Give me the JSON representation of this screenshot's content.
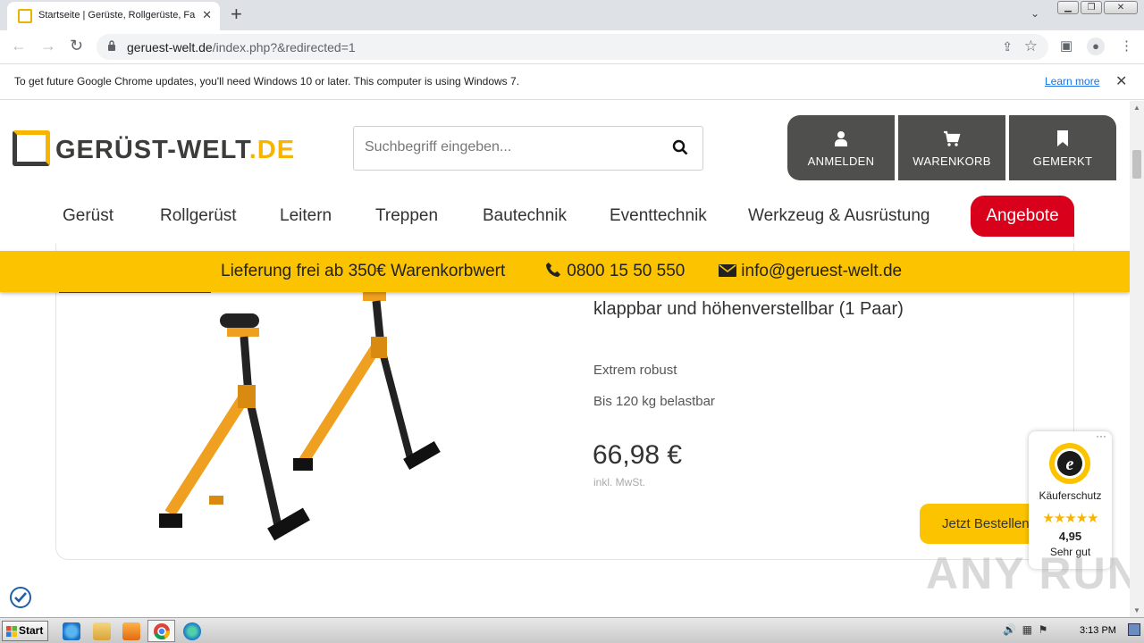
{
  "browser": {
    "tab_title": "Startseite | Gerüste, Rollgerüste, Fa",
    "url_domain": "geruest-welt.de",
    "url_path": "/index.php?&redirected=1"
  },
  "infobar": {
    "message": "To get future Google Chrome updates, you'll need Windows 10 or later. This computer is using Windows 7.",
    "learn_more": "Learn more"
  },
  "site": {
    "logo_main": "GERÜST-WELT",
    "logo_tld": ".DE",
    "search_placeholder": "Suchbegriff eingeben...",
    "header_buttons": [
      {
        "label": "ANMELDEN",
        "icon": "user-icon"
      },
      {
        "label": "WARENKORB",
        "icon": "cart-icon"
      },
      {
        "label": "GEMERKT",
        "icon": "bookmark-icon"
      }
    ],
    "nav": [
      "Gerüst",
      "Rollgerüst",
      "Leitern",
      "Treppen",
      "Bautechnik",
      "Eventtechnik",
      "Werkzeug & Ausrüstung",
      "Angebote"
    ],
    "info_bar": {
      "delivery": "Lieferung frei ab 350€ Warenkorbwert",
      "phone": "0800 15 50 550",
      "email": "info@geruest-welt.de"
    }
  },
  "product": {
    "title_line": "klappbar und höhenverstellbar (1 Paar)",
    "features": [
      "Extrem robust",
      "Bis 120 kg belastbar"
    ],
    "price": "66,98 €",
    "vat_note": "inkl. MwSt.",
    "buy_label": "Jetzt Bestellen"
  },
  "trusted_shops": {
    "label": "Käuferschutz",
    "stars": "★★★★★",
    "score": "4,95",
    "grade": "Sehr gut"
  },
  "watermark": "ANY RUN",
  "taskbar": {
    "start": "Start",
    "time": "3:13 PM"
  },
  "colors": {
    "brand_yellow": "#fcc400",
    "brand_dark": "#4f4f4d",
    "offer_red": "#d9001b"
  }
}
